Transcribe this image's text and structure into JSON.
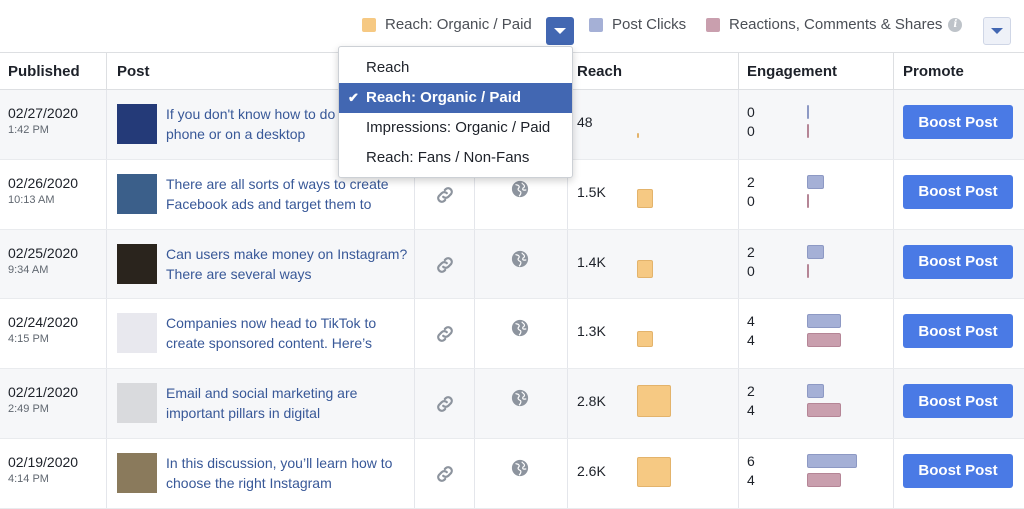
{
  "legend": {
    "reach_label": "Reach: Organic / Paid",
    "clicks_label": "Post Clicks",
    "reactions_label": "Reactions, Comments & Shares",
    "info_glyph": "i",
    "colors": {
      "reach": "#f6c983",
      "clicks": "#a5b0d6",
      "reactions": "#c99fae"
    }
  },
  "menu": {
    "items": [
      "Reach",
      "Reach: Organic / Paid",
      "Impressions: Organic / Paid",
      "Reach: Fans / Non-Fans"
    ],
    "selected_index": 1,
    "check": "✔"
  },
  "columns": {
    "published": "Published",
    "post": "Post",
    "reach": "Reach",
    "engagement": "Engagement",
    "promote": "Promote"
  },
  "rows": [
    {
      "date": "02/27/2020",
      "time": "1:42 PM",
      "text": "If you don't know how to do it on your phone or on a desktop",
      "reach": "48",
      "reach_frac": 0.02,
      "clicks": "0",
      "reactions": "0",
      "clicks_frac": 0.0,
      "reactions_frac": 0.0,
      "boost": "Boost Post",
      "thumb": "#243a78"
    },
    {
      "date": "02/26/2020",
      "time": "10:13 AM",
      "text": "There are all sorts of ways to create Facebook ads and target them to",
      "reach": "1.5K",
      "reach_frac": 0.54,
      "clicks": "2",
      "reactions": "0",
      "clicks_frac": 0.33,
      "reactions_frac": 0.0,
      "boost": "Boost Post",
      "thumb": "#3b5f8a"
    },
    {
      "date": "02/25/2020",
      "time": "9:34 AM",
      "text": "Can users make money on Instagram? There are several ways",
      "reach": "1.4K",
      "reach_frac": 0.5,
      "clicks": "2",
      "reactions": "0",
      "clicks_frac": 0.33,
      "reactions_frac": 0.0,
      "boost": "Boost Post",
      "thumb": "#2a241d"
    },
    {
      "date": "02/24/2020",
      "time": "4:15 PM",
      "text": "Companies now head to TikTok to create sponsored content. Here’s",
      "reach": "1.3K",
      "reach_frac": 0.46,
      "clicks": "4",
      "reactions": "4",
      "clicks_frac": 0.67,
      "reactions_frac": 0.67,
      "boost": "Boost Post",
      "thumb": "#e8e8ee"
    },
    {
      "date": "02/21/2020",
      "time": "2:49 PM",
      "text": "Email and social marketing are important pillars in digital",
      "reach": "2.8K",
      "reach_frac": 1.0,
      "clicks": "2",
      "reactions": "4",
      "clicks_frac": 0.33,
      "reactions_frac": 0.67,
      "boost": "Boost Post",
      "thumb": "#d9dadd"
    },
    {
      "date": "02/19/2020",
      "time": "4:14 PM",
      "text": "In this discussion, you’ll learn how to choose the right Instagram",
      "reach": "2.6K",
      "reach_frac": 0.93,
      "clicks": "6",
      "reactions": "4",
      "clicks_frac": 1.0,
      "reactions_frac": 0.67,
      "boost": "Boost Post",
      "thumb": "#8a7a5c"
    }
  ]
}
